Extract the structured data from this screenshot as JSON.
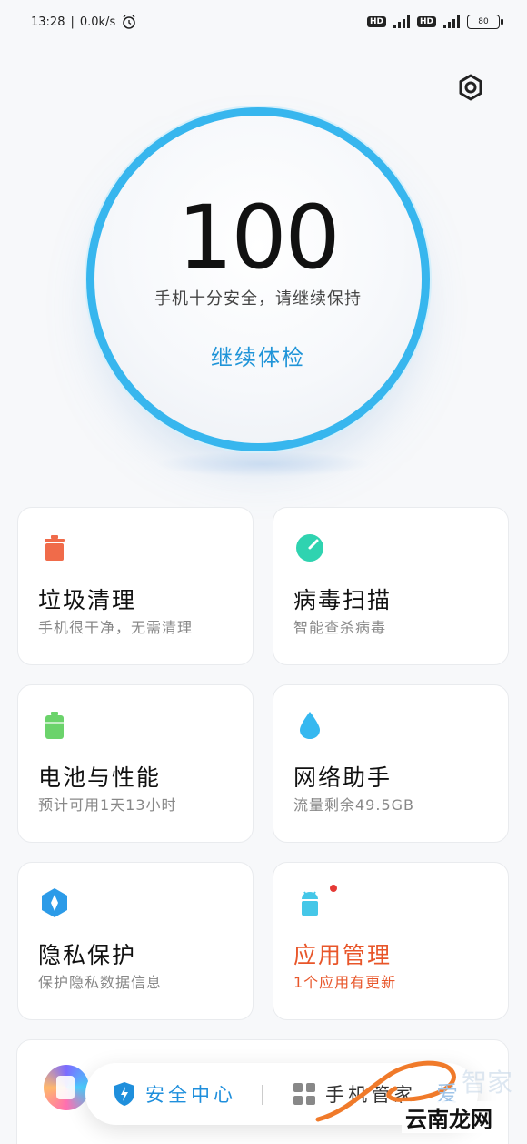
{
  "status_bar": {
    "time": "13:28",
    "speed": "0.0k/s",
    "sim1": "HD",
    "sim2": "HD",
    "battery": "80"
  },
  "score": {
    "value": "100",
    "subtitle": "手机十分安全，请继续保持",
    "action": "继续体检",
    "accent_color": "#37b6ee"
  },
  "cards": [
    {
      "title": "垃圾清理",
      "desc": "手机很干净，无需清理",
      "icon": "trash-icon",
      "color": "#f06b4a"
    },
    {
      "title": "病毒扫描",
      "desc": "智能查杀病毒",
      "icon": "scan-icon",
      "color": "#2fd3b0"
    },
    {
      "title": "电池与性能",
      "desc": "预计可用1天13小时",
      "icon": "battery-icon",
      "color": "#6bd36b"
    },
    {
      "title": "网络助手",
      "desc": "流量剩余49.5GB",
      "icon": "water-drop-icon",
      "color": "#35b8f0"
    },
    {
      "title": "隐私保护",
      "desc": "保护隐私数据信息",
      "icon": "shield-icon",
      "color": "#2c9be8"
    },
    {
      "title": "应用管理",
      "desc": "1个应用有更新",
      "icon": "android-icon",
      "color": "#45c7e8"
    }
  ],
  "tabbar": {
    "security_label": "安全中心",
    "manager_label": "手机管家"
  },
  "watermark": {
    "ai": "爱",
    "faded": "智家",
    "main": "云南龙网"
  }
}
